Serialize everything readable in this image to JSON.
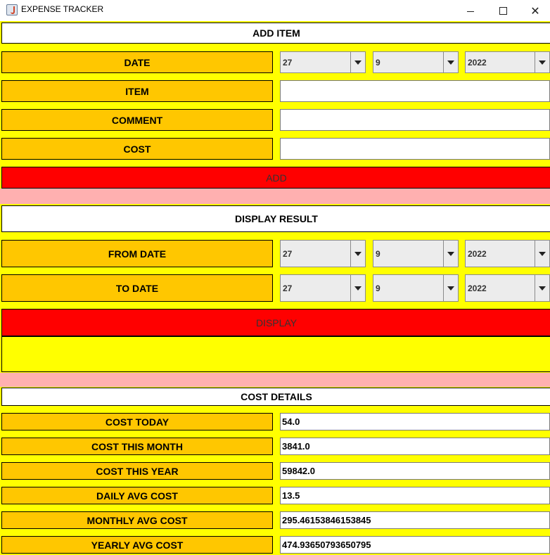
{
  "window": {
    "title": "EXPENSE TRACKER"
  },
  "add_item": {
    "header": "ADD ITEM",
    "date_label": "DATE",
    "item_label": "ITEM",
    "comment_label": "COMMENT",
    "cost_label": "COST",
    "date": {
      "day": "27",
      "month": "9",
      "year": "2022"
    },
    "item_value": "",
    "comment_value": "",
    "cost_value": "",
    "add_button": "ADD"
  },
  "display_result": {
    "header": "DISPLAY RESULT",
    "from_label": "FROM DATE",
    "to_label": "TO DATE",
    "from_date": {
      "day": "27",
      "month": "9",
      "year": "2022"
    },
    "to_date": {
      "day": "27",
      "month": "9",
      "year": "2022"
    },
    "display_button": "DISPLAY",
    "result_text": ""
  },
  "cost_details": {
    "header": "COST DETAILS",
    "rows": [
      {
        "label": "COST TODAY",
        "value": "54.0"
      },
      {
        "label": "COST THIS MONTH",
        "value": "3841.0"
      },
      {
        "label": "COST THIS YEAR",
        "value": "59842.0"
      },
      {
        "label": "DAILY AVG COST",
        "value": "13.5"
      },
      {
        "label": "MONTHLY AVG COST",
        "value": "295.46153846153845"
      },
      {
        "label": "YEARLY AVG COST",
        "value": "474.93650793650795"
      }
    ]
  },
  "colors": {
    "panel": "#ffff00",
    "label": "#ffc700",
    "button": "#ff0000",
    "separator": "#ffb0b0"
  },
  "icons": [
    "java-app-icon",
    "minimize-icon",
    "maximize-icon",
    "close-icon",
    "chevron-down-icon"
  ]
}
